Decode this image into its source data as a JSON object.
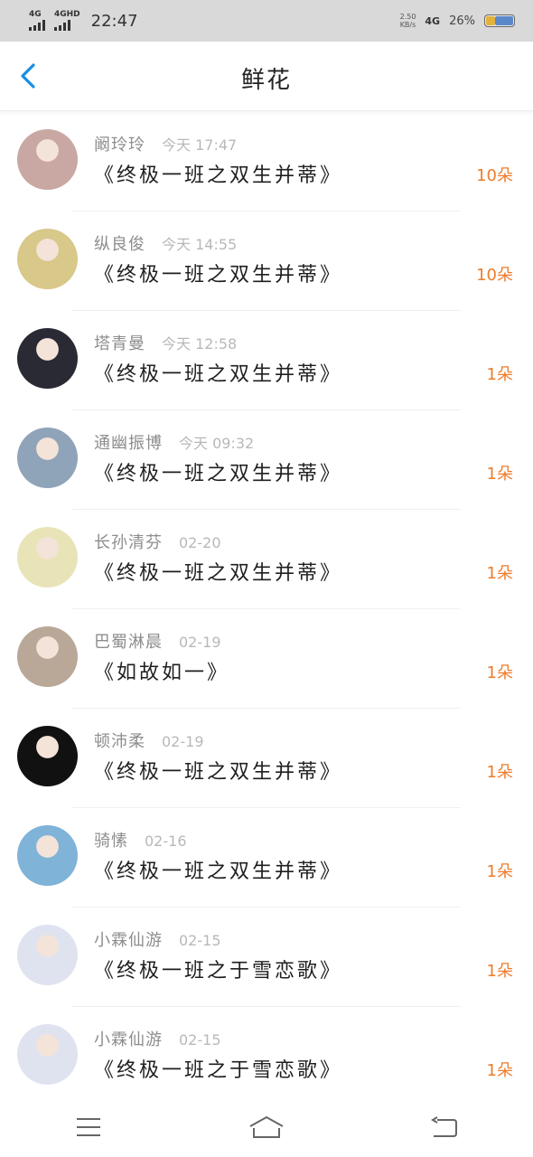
{
  "status_bar": {
    "sim1_label": "4G",
    "sim2_label": "4GHD",
    "time": "22:47",
    "speed_value": "2.50",
    "speed_unit": "KB/s",
    "network": "4G",
    "battery": "26%",
    "battery_level": 0.26
  },
  "header": {
    "title": "鲜花"
  },
  "list": [
    {
      "name": "阚玲玲",
      "time": "今天 17:47",
      "gift": "《终极一班之双生并蒂》",
      "count": "10朵",
      "avatar_icon": "girl-photo-avatar",
      "avatar_color": "#c9a7a3"
    },
    {
      "name": "纵良俊",
      "time": "今天 14:55",
      "gift": "《终极一班之双生并蒂》",
      "count": "10朵",
      "avatar_icon": "anime-blonde-avatar",
      "avatar_color": "#d8c889"
    },
    {
      "name": "塔青曼",
      "time": "今天 12:58",
      "gift": "《终极一班之双生并蒂》",
      "count": "1朵",
      "avatar_icon": "anime-dark-hair-avatar",
      "avatar_color": "#2a2a34"
    },
    {
      "name": "通幽振博",
      "time": "今天 09:32",
      "gift": "《终极一班之双生并蒂》",
      "count": "1朵",
      "avatar_icon": "vintage-car-avatar",
      "avatar_color": "#8fa4b8"
    },
    {
      "name": "长孙清芬",
      "time": "02-20",
      "gift": "《终极一班之双生并蒂》",
      "count": "1朵",
      "avatar_icon": "zebra-avatar",
      "avatar_color": "#e8e4b8"
    },
    {
      "name": "巴蜀淋晨",
      "time": "02-19",
      "gift": "《如故如一》",
      "count": "1朵",
      "avatar_icon": "girl-text-avatar",
      "avatar_color": "#b9a898"
    },
    {
      "name": "顿沛柔",
      "time": "02-19",
      "gift": "《终极一班之双生并蒂》",
      "count": "1朵",
      "avatar_icon": "black-text-avatar",
      "avatar_color": "#111111"
    },
    {
      "name": "骑愫",
      "time": "02-16",
      "gift": "《终极一班之双生并蒂》",
      "count": "1朵",
      "avatar_icon": "sky-landscape-avatar",
      "avatar_color": "#7fb3d8"
    },
    {
      "name": "小霖仙游",
      "time": "02-15",
      "gift": "《终极一班之于雪恋歌》",
      "count": "1朵",
      "avatar_icon": "anime-white-hair-avatar",
      "avatar_color": "#dfe3f0"
    },
    {
      "name": "小霖仙游",
      "time": "02-15",
      "gift": "《终极一班之于雪恋歌》",
      "count": "1朵",
      "avatar_icon": "anime-white-hair-avatar",
      "avatar_color": "#dfe3f0"
    }
  ],
  "nav_bar": {
    "menu_icon": "menu-icon",
    "home_icon": "home-icon",
    "back_icon": "back-icon"
  },
  "colors": {
    "accent": "#1a8fe3",
    "count": "#ee7c2b",
    "name": "#8d8d8d",
    "time": "#b8b8b8"
  }
}
